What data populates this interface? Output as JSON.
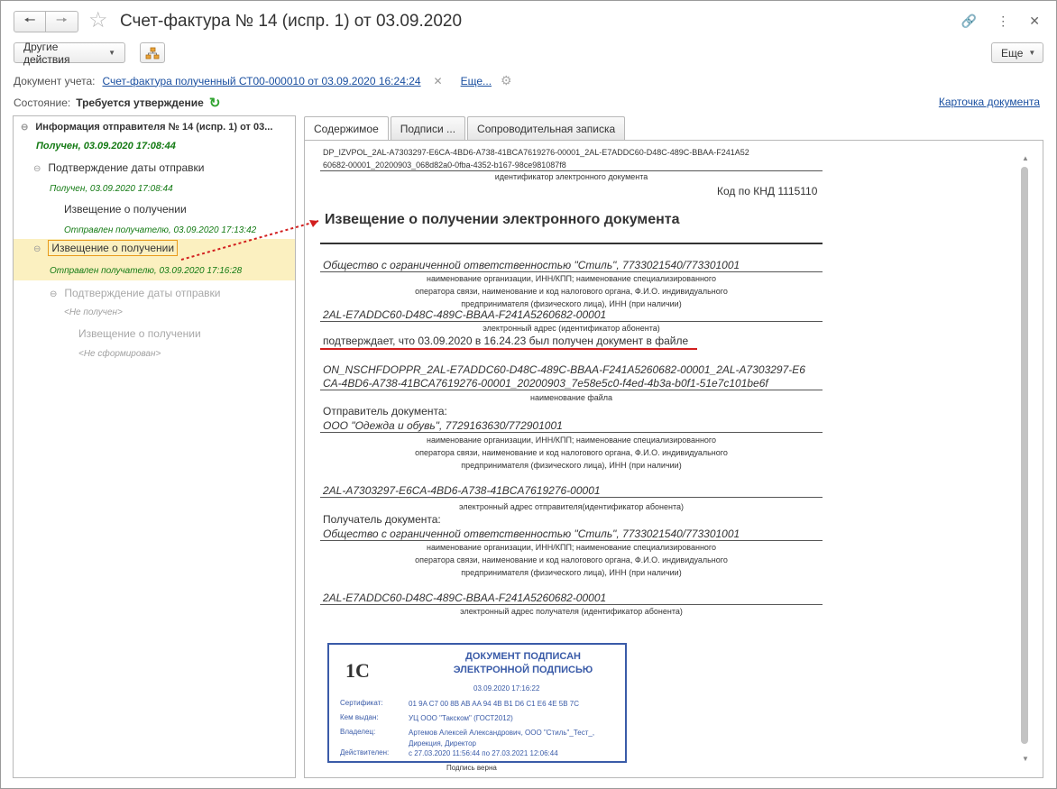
{
  "header": {
    "title": "Счет-фактура № 14 (испр. 1) от 03.09.2020"
  },
  "toolbar": {
    "other_actions": "Другие действия",
    "more": "Еще"
  },
  "doc_row": {
    "label": "Документ учета:",
    "link": "Счет-фактура полученный СТ00-000010 от 03.09.2020 16:24:24",
    "more_link": "Еще..."
  },
  "state_row": {
    "label": "Состояние:",
    "value": "Требуется утверждение",
    "card_link": "Карточка документа"
  },
  "tree": {
    "root": "Информация отправителя № 14 (испр. 1) от 03...",
    "root_status": "Получен, 03.09.2020 17:08:44",
    "n1": "Подтверждение даты отправки",
    "n1_status": "Получен, 03.09.2020 17:08:44",
    "n2": "Извещение о получении",
    "n2_status": "Отправлен получателю, 03.09.2020 17:13:42",
    "n3": "Извещение о получении",
    "n3_status": "Отправлен получателю, 03.09.2020 17:16:28",
    "n4": "Подтверждение даты отправки",
    "n4_status": "<Не получен>",
    "n5": "Извещение о получении",
    "n5_status": "<Не сформирован>"
  },
  "tabs": [
    "Содержимое",
    "Подписи ...",
    "Сопроводительная записка"
  ],
  "doc": {
    "id_line1": "DP_IZVPOL_2AL-A7303297-E6CA-4BD6-A738-41BCA7619276-00001_2AL-E7ADDC60-D48C-489C-BBAA-F241A52",
    "id_line2": "60682-00001_20200903_068d82a0-0fba-4352-b167-98ce981087f8",
    "id_caption": "идентификатор электронного документа",
    "knd": "Код по КНД 1115110",
    "heading": "Извещение о получении электронного документа",
    "org1": "Общество с ограниченной ответственностью \"Стиль\", 7733021540/773301001",
    "cap_org_1": "наименование организации, ИНН/КПП; наименование специализированного",
    "cap_org_2": "оператора связи, наименование и код налогового органа, Ф.И.О. индивидуального",
    "cap_org_3": "предпринимателя (физического лица), ИНН (при наличии)",
    "addr1": "2AL-E7ADDC60-D48C-489C-BBAA-F241A5260682-00001",
    "cap_addr": "электронный адрес (идентификатор абонента)",
    "confirm": "подтверждает, что 03.09.2020 в 16.24.23 был получен документ в файле",
    "file1": "ON_NSCHFDOPPR_2AL-E7ADDC60-D48C-489C-BBAA-F241A5260682-00001_2AL-A7303297-E6",
    "file2": "CA-4BD6-A738-41BCA7619276-00001_20200903_7e58e5c0-f4ed-4b3a-b0f1-51e7c101be6f",
    "cap_file": "наименование файла",
    "sender_label": "Отправитель документа:",
    "sender": "ООО \"Одежда и обувь\", 7729163630/772901001",
    "sender_addr": "2AL-A7303297-E6CA-4BD6-A738-41BCA7619276-00001",
    "cap_sender_addr": "электронный адрес отправителя(идентификатор абонента)",
    "receiver_label": "Получатель документа:",
    "receiver": "Общество с ограниченной ответственностью \"Стиль\", 7733021540/773301001",
    "receiver_addr": "2AL-E7ADDC60-D48C-489C-BBAA-F241A5260682-00001",
    "cap_receiver_addr": "электронный адрес получателя (идентификатор абонента)"
  },
  "stamp": {
    "logo": "1С",
    "title1": "ДОКУМЕНТ ПОДПИСАН",
    "title2": "ЭЛЕКТРОННОЙ ПОДПИСЬЮ",
    "date": "03.09.2020 17:16:22",
    "cert_label": "Сертификат:",
    "cert_value": "01 9A C7 00 8B AB AA 94 4B B1 D6 C1 E6 4E 5B 7C",
    "issuer_label": "Кем выдан:",
    "issuer_value": "УЦ ООО \"Такском\" (ГОСТ2012)",
    "owner_label": "Владелец:",
    "owner_value": "Артемов Алексей Александрович, ООО \"Стиль\"_Тест_, Дирекция, Директор",
    "valid_label": "Действителен:",
    "valid_value": "с 27.03.2020 11:56:44 по 27.03.2021 12:06:44",
    "below": "Подпись верна"
  },
  "colors": {
    "accent_link": "#1a4fa0",
    "status_green": "#137a13",
    "highlight": "#fbf0c0",
    "annotation_red": "#d21f1f",
    "stamp_blue": "#3a5ba8"
  }
}
